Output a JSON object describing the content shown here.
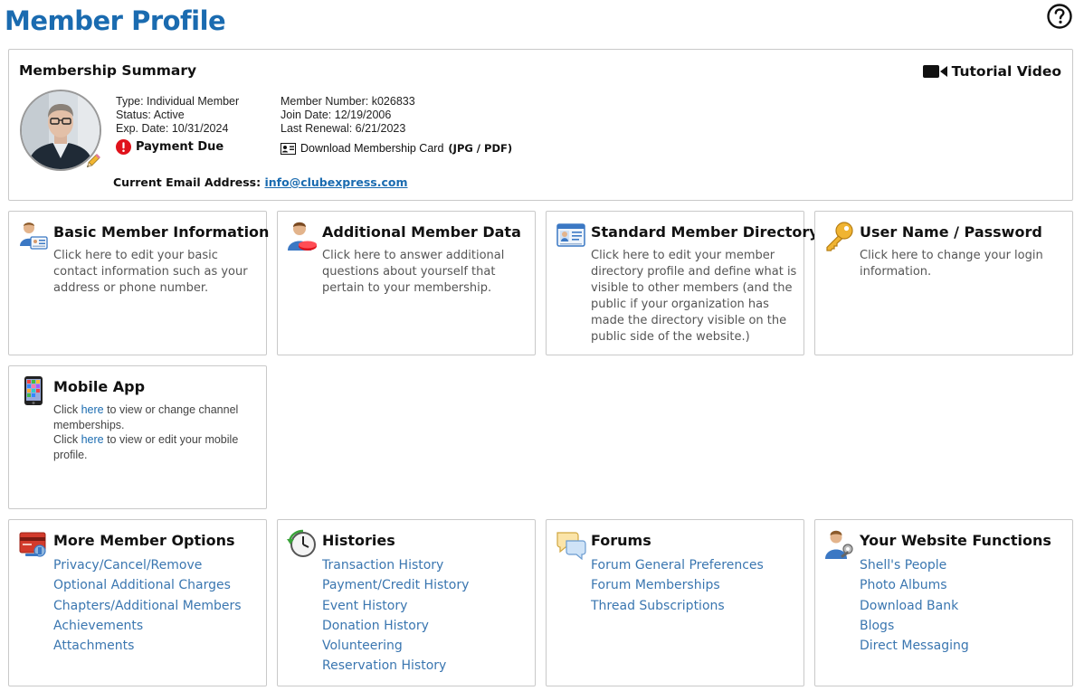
{
  "page": {
    "title": "Member Profile"
  },
  "help": {
    "icon": "help-circle-icon"
  },
  "summary": {
    "title": "Membership Summary",
    "tutorial_label": "Tutorial Video",
    "type": "Type: Individual Member",
    "status": "Status: Active",
    "exp_date": "Exp. Date: 10/31/2024",
    "payment_due": "Payment Due",
    "member_number": "Member Number: k026833",
    "join_date": "Join Date: 12/19/2006",
    "last_renewal": "Last Renewal: 6/21/2023",
    "card_label": "Download Membership Card",
    "card_formats": "(JPG / PDF)",
    "email_label": "Current Email Address:",
    "email": "info@clubexpress.com"
  },
  "tiles": {
    "basic": {
      "title": "Basic Member Information",
      "desc": "Click here to edit your basic contact information such as your address or phone number."
    },
    "additional": {
      "title": "Additional Member Data",
      "desc": "Click here to answer additional questions about yourself that pertain to your membership."
    },
    "directory": {
      "title": "Standard Member Directory",
      "desc": "Click here to edit your member directory profile and define what is visible to other members (and the public if your organization has made the directory visible on the public side of the website.)"
    },
    "login": {
      "title": "User Name / Password",
      "desc": "Click here to change your login information."
    },
    "mobile": {
      "title": "Mobile App",
      "line1_pre": "Click ",
      "line1_link": "here",
      "line1_post": " to view or change channel memberships.",
      "line2_pre": "Click ",
      "line2_link": "here",
      "line2_post": " to view or edit your mobile profile."
    },
    "more": {
      "title": "More Member Options",
      "links": [
        "Privacy/Cancel/Remove",
        "Optional Additional Charges",
        "Chapters/Additional Members",
        "Achievements",
        "Attachments"
      ]
    },
    "histories": {
      "title": "Histories",
      "links": [
        "Transaction History",
        "Payment/Credit History",
        "Event History",
        "Donation History",
        "Volunteering",
        "Reservation History"
      ]
    },
    "forums": {
      "title": "Forums",
      "links": [
        "Forum General Preferences",
        "Forum Memberships",
        "Thread Subscriptions"
      ]
    },
    "website": {
      "title": "Your Website Functions",
      "links": [
        "Shell's People",
        "Photo Albums",
        "Download Bank",
        "Blogs",
        "Direct Messaging"
      ]
    }
  },
  "colors": {
    "brand_blue": "#1a6bb0",
    "link_blue": "#3a76b0",
    "alert_red": "#e0121b",
    "border": "#c9c9c9"
  }
}
